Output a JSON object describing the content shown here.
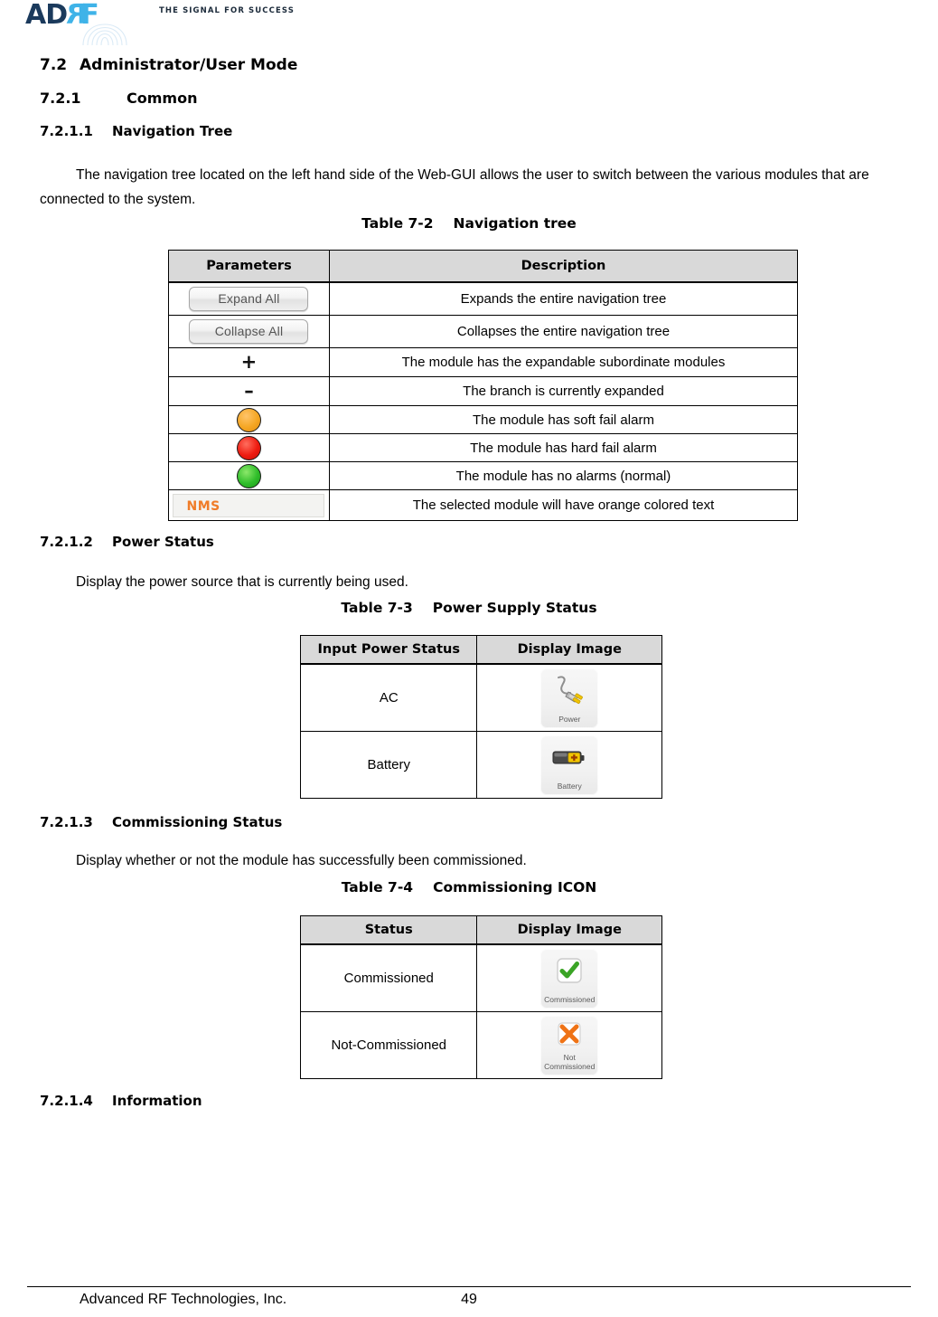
{
  "header": {
    "logo_text_dark": "AD",
    "logo_text_r": "R",
    "logo_text_f": "F",
    "tagline": "THE SIGNAL FOR SUCCESS",
    "brand_dark": "#1b3a5c",
    "brand_light": "#3fb3e8"
  },
  "sections": {
    "s72_num": "7.2",
    "s72_title": "Administrator/User Mode",
    "s721_num": "7.2.1",
    "s721_title": "Common",
    "s7211_num": "7.2.1.1",
    "s7211_title": "Navigation Tree",
    "s7211_body": "The navigation tree located on the left hand side of the Web-GUI allows the user to switch between the various modules that are connected to the system.",
    "s7212_num": "7.2.1.2",
    "s7212_title": "Power Status",
    "s7212_body": "Display the power source that is currently being used.",
    "s7213_num": "7.2.1.3",
    "s7213_title": "Commissioning Status",
    "s7213_body": "Display whether or not the module has successfully been commissioned.",
    "s7214_num": "7.2.1.4",
    "s7214_title": "Information"
  },
  "nav_table": {
    "caption_label": "Table 7-2",
    "caption_title": "Navigation tree",
    "headers": [
      "Parameters",
      "Description"
    ],
    "rows": [
      {
        "type": "button",
        "param": "Expand All",
        "desc": "Expands the entire navigation tree"
      },
      {
        "type": "button",
        "param": "Collapse All",
        "desc": "Collapses the entire navigation tree"
      },
      {
        "type": "glyph",
        "param": "+",
        "desc": "The module has the expandable subordinate modules"
      },
      {
        "type": "glyph",
        "param": "–",
        "desc": "The branch is currently expanded"
      },
      {
        "type": "led",
        "param": "orange",
        "color": "#f5a623",
        "desc": "The module has soft fail alarm"
      },
      {
        "type": "led",
        "param": "red",
        "color": "#ee1b10",
        "desc": "The module has hard fail alarm"
      },
      {
        "type": "led",
        "param": "green",
        "color": "#2fbd2a",
        "desc": "The module has no alarms (normal)"
      },
      {
        "type": "chip",
        "param": "NMS",
        "chip_color": "#f07c28",
        "desc": "The selected module will have orange colored text"
      }
    ]
  },
  "power_table": {
    "caption_label": "Table 7-3",
    "caption_title": "Power Supply Status",
    "headers": [
      "Input Power Status",
      "Display Image"
    ],
    "rows": [
      {
        "status": "AC",
        "icon_label": "Power"
      },
      {
        "status": "Battery",
        "icon_label": "Battery"
      }
    ]
  },
  "commission_table": {
    "caption_label": "Table 7-4",
    "caption_title": "Commissioning ICON",
    "headers": [
      "Status",
      "Display Image"
    ],
    "rows": [
      {
        "status": "Commissioned",
        "icon_label": "Commissioned"
      },
      {
        "status": "Not-Commissioned",
        "icon_label_line1": "Not",
        "icon_label_line2": "Commissioned"
      }
    ]
  },
  "footer": {
    "company": "Advanced RF Technologies, Inc.",
    "page_number": "49"
  }
}
